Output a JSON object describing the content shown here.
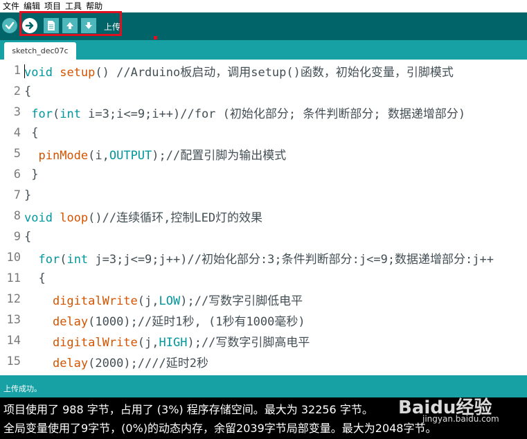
{
  "menu": [
    "文件",
    "编辑",
    "项目",
    "工具",
    "帮助"
  ],
  "toolbar": {
    "verify_icon": "check-icon",
    "upload_icon": "arrow-right-icon",
    "new_icon": "document-icon",
    "open_icon": "arrow-up-icon",
    "save_icon": "arrow-down-icon",
    "label": "上传"
  },
  "tab": {
    "name": "sketch_dec07c"
  },
  "code": [
    "void setup() //Arduino板启动，调用setup()函数，初始化变量，引脚模式",
    "{",
    " for(int i=3;i<=9;i++)//for (初始化部分; 条件判断部分; 数据递增部分)",
    " {",
    "  pinMode(i,OUTPUT);//配置引脚为输出模式",
    " }",
    "}",
    "void loop()//连续循环,控制LED灯的效果",
    "{",
    "  for(int j=3;j<=9;j++)//初始化部分:3;条件判断部分:j<=9;数据递增部分:j++",
    "  {",
    "    digitalWrite(j,LOW);//写数字引脚低电平",
    "    delay(1000);//延时1秒, (1秒有1000毫秒)",
    "    digitalWrite(j,HIGH);//写数字引脚高电平",
    "    delay(2000);////延时2秒"
  ],
  "status": {
    "text": "上传成功。"
  },
  "console": [
    "项目使用了 988 字节，占用了 (3%) 程序存储空间。最大为 32256 字节。",
    "全局变量使用了9字节，(0%)的动态内存，余留2039字节局部变量。最大为2048字节。"
  ],
  "watermark": {
    "brand": "Baidu经验",
    "site": "jingyan.baidu.com"
  },
  "colors": {
    "toolbar_bg": "#006468",
    "tab_strip_bg": "#17a1a5",
    "button_bg": "#4db7bb",
    "keyword": "#00979c",
    "function": "#d35400",
    "highlight": "#e01020"
  }
}
